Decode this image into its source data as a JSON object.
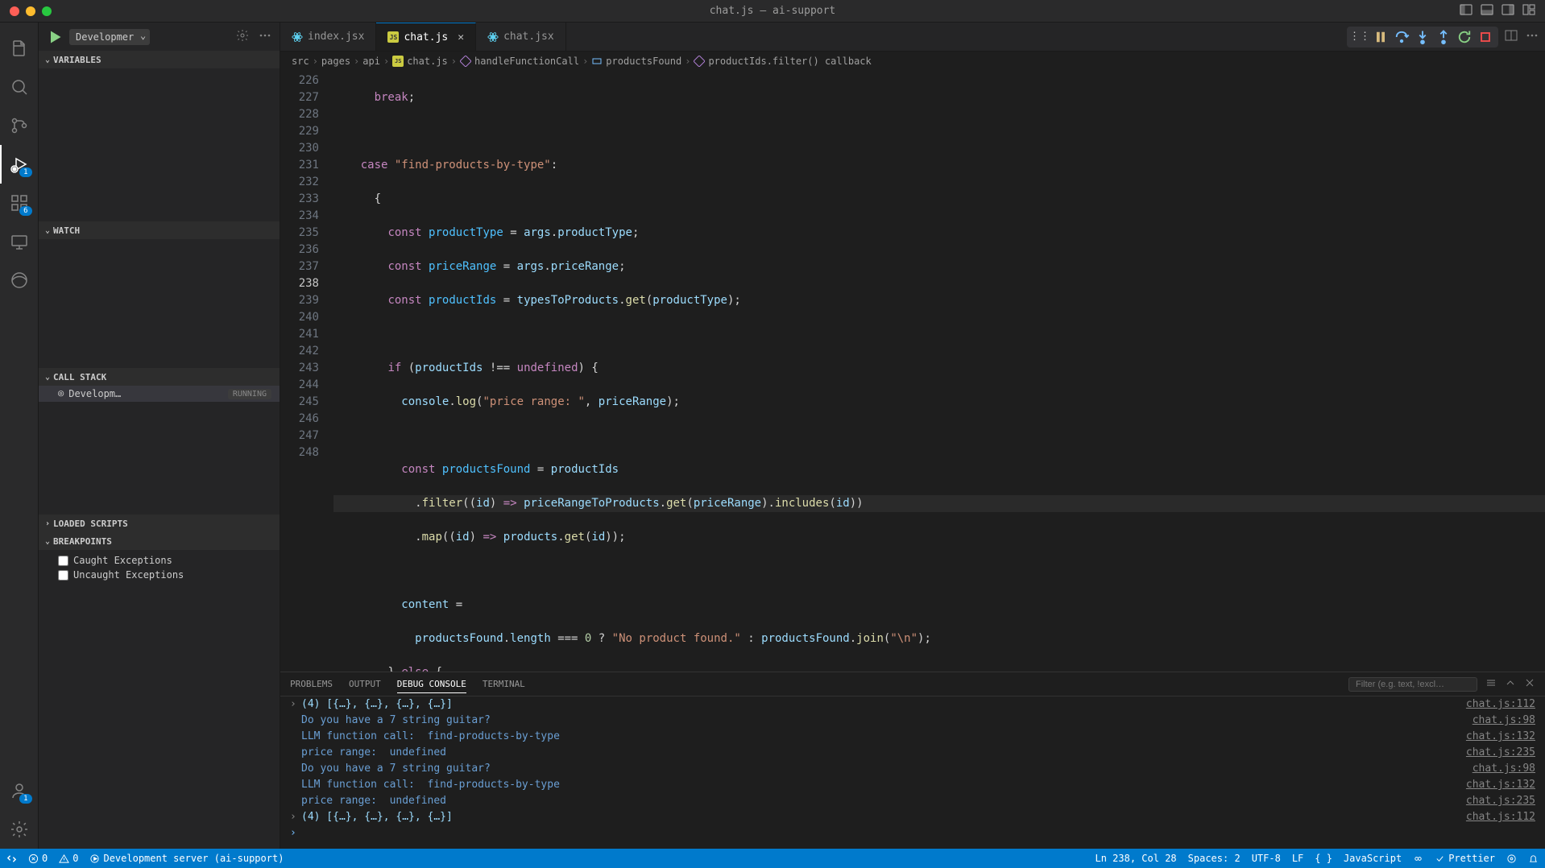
{
  "window": {
    "title": "chat.js — ai-support"
  },
  "activitybar": {
    "debugBadge": "1",
    "extBadge": "6",
    "accountBadge": "1"
  },
  "sidebar": {
    "configLabel": "Developmer",
    "sections": {
      "variables": "VARIABLES",
      "watch": "WATCH",
      "callStack": "CALL STACK",
      "loadedScripts": "LOADED SCRIPTS",
      "breakpoints": "BREAKPOINTS"
    },
    "callStack": {
      "name": "Developm…",
      "status": "RUNNING"
    },
    "breakpointItems": {
      "caught": "Caught Exceptions",
      "uncaught": "Uncaught Exceptions"
    }
  },
  "tabs": [
    {
      "label": "index.jsx",
      "type": "react",
      "active": false
    },
    {
      "label": "chat.js",
      "type": "js",
      "active": true,
      "mod": true
    },
    {
      "label": "chat.jsx",
      "type": "react",
      "active": false
    }
  ],
  "breadcrumb": {
    "p0": "src",
    "p1": "pages",
    "p2": "api",
    "p3": "chat.js",
    "p4": "handleFunctionCall",
    "p5": "productsFound",
    "p6": "productIds.filter() callback"
  },
  "code": {
    "lines": [
      "226",
      "227",
      "228",
      "229",
      "230",
      "231",
      "232",
      "233",
      "234",
      "235",
      "236",
      "237",
      "238",
      "239",
      "240",
      "241",
      "242",
      "243",
      "244",
      "245",
      "246",
      "247",
      "248"
    ]
  },
  "panel": {
    "tabs": {
      "problems": "PROBLEMS",
      "output": "OUTPUT",
      "debug": "DEBUG CONSOLE",
      "terminal": "TERMINAL"
    },
    "filterPlaceholder": "Filter (e.g. text, !excl…",
    "lines": [
      {
        "expand": "›",
        "text": "(4) [{…}, {…}, {…}, {…}]",
        "cls": "lightblue",
        "src": "chat.js:112"
      },
      {
        "text": "Do you have a 7 string guitar?",
        "cls": "blue",
        "src": "chat.js:98"
      },
      {
        "text": "LLM function call:  find-products-by-type",
        "cls": "blue",
        "src": "chat.js:132"
      },
      {
        "text": "price range:  undefined",
        "cls": "blue",
        "src": "chat.js:235"
      },
      {
        "text": "Do you have a 7 string guitar?",
        "cls": "blue",
        "src": "chat.js:98"
      },
      {
        "text": "LLM function call:  find-products-by-type",
        "cls": "blue",
        "src": "chat.js:132"
      },
      {
        "text": "price range:  undefined",
        "cls": "blue",
        "src": "chat.js:235"
      },
      {
        "expand": "›",
        "text": "(4) [{…}, {…}, {…}, {…}]",
        "cls": "lightblue",
        "src": "chat.js:112"
      }
    ]
  },
  "statusbar": {
    "errors": "0",
    "warnings": "0",
    "server": "Development server (ai-support)",
    "pos": "Ln 238, Col 28",
    "spaces": "Spaces: 2",
    "enc": "UTF-8",
    "eol": "LF",
    "lang": "JavaScript",
    "prettier": "Prettier"
  }
}
